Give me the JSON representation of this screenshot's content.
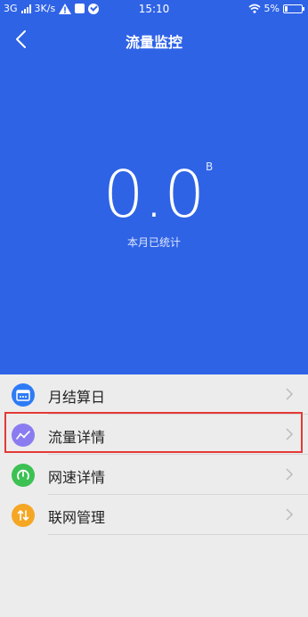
{
  "status_bar": {
    "network": "3G",
    "speed": "3K/s",
    "time": "15:10",
    "battery": "5%"
  },
  "nav": {
    "title": "流量监控"
  },
  "summary": {
    "value": "0.0",
    "unit": "B",
    "caption": "本月已统计"
  },
  "menu": {
    "items": [
      {
        "label": "月结算日",
        "icon": "calendar-icon",
        "color": "#2f7bf5"
      },
      {
        "label": "流量详情",
        "icon": "trend-line-icon",
        "color": "#8a7cf0"
      },
      {
        "label": "网速详情",
        "icon": "speedometer-icon",
        "color": "#3cc152"
      },
      {
        "label": "联网管理",
        "icon": "up-down-arrows-icon",
        "color": "#f5a623"
      }
    ]
  },
  "colors": {
    "header_bg": "#2f63e6",
    "page_bg": "#ececec",
    "highlight": "#e53935"
  }
}
